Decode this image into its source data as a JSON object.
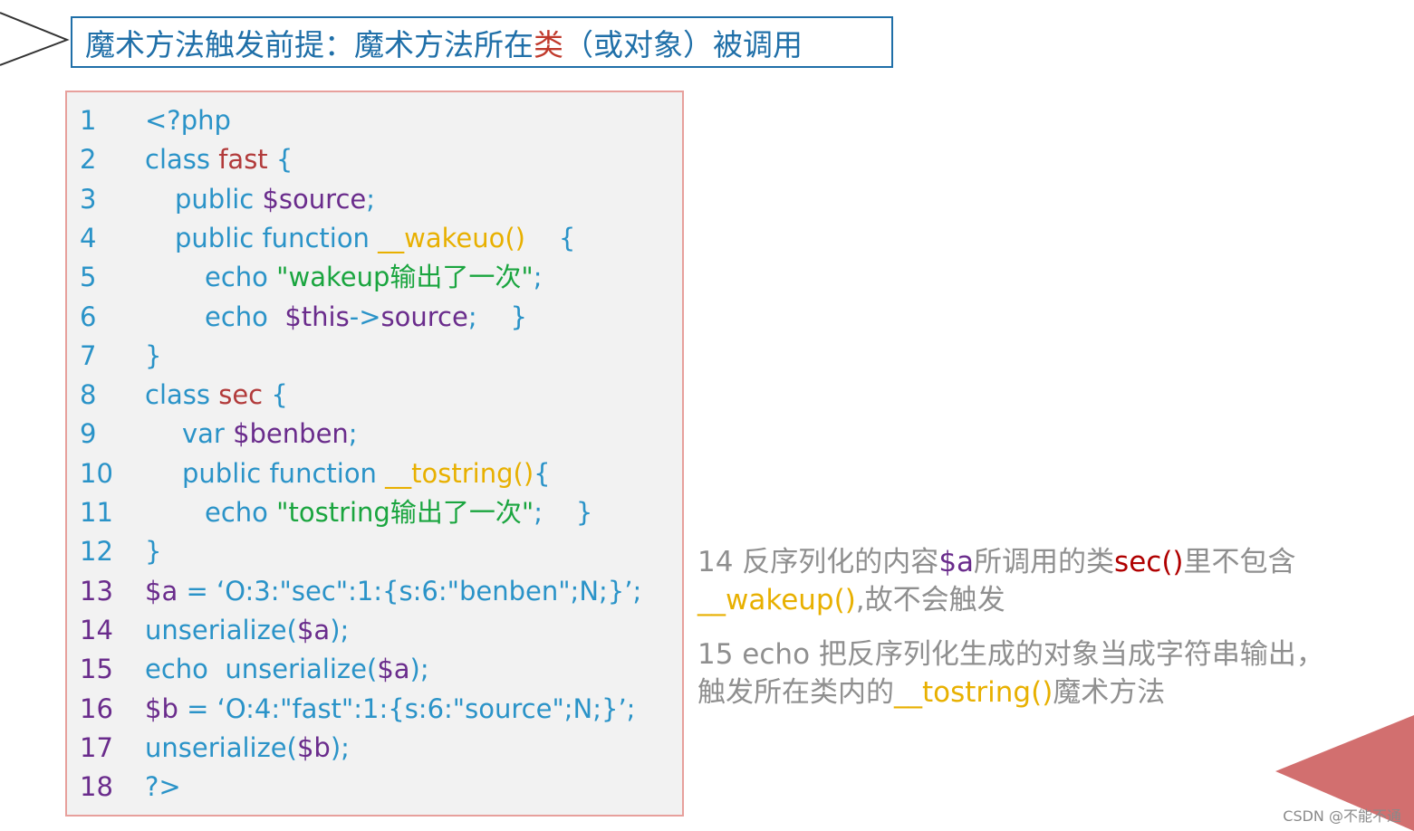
{
  "title": {
    "part1": "魔术方法触发前提：魔术方法所在",
    "part_highlight": "类",
    "part2": "（或对象）被调用"
  },
  "code_lines": [
    {
      "no": "1",
      "segments": [
        {
          "t": "<?php",
          "c": "kw"
        }
      ]
    },
    {
      "no": "2",
      "segments": [
        {
          "t": "class ",
          "c": "kw"
        },
        {
          "t": "fast",
          "c": "cn"
        },
        {
          "t": " {",
          "c": "kw"
        }
      ]
    },
    {
      "no": "3",
      "segments": [
        {
          "t": "public ",
          "c": "kw"
        },
        {
          "t": "$source",
          "c": "vr"
        },
        {
          "t": ";",
          "c": "kw"
        }
      ]
    },
    {
      "no": "4",
      "segments": [
        {
          "t": "public function ",
          "c": "kw"
        },
        {
          "t": "__wakeuo()",
          "c": "fn"
        },
        {
          "t": "    {",
          "c": "kw"
        }
      ]
    },
    {
      "no": "5",
      "segments": [
        {
          "t": "echo ",
          "c": "kw"
        },
        {
          "t": "\"wakeup输出了一次\"",
          "c": "st"
        },
        {
          "t": ";",
          "c": "kw"
        }
      ]
    },
    {
      "no": "6",
      "segments": [
        {
          "t": "echo  ",
          "c": "kw"
        },
        {
          "t": "$this",
          "c": "vr"
        },
        {
          "t": "->",
          "c": "kw"
        },
        {
          "t": "source",
          "c": "vr"
        },
        {
          "t": ";    }",
          "c": "kw"
        }
      ]
    },
    {
      "no": "7",
      "segments": [
        {
          "t": "}",
          "c": "kw"
        }
      ]
    },
    {
      "no": "8",
      "segments": [
        {
          "t": "class ",
          "c": "kw"
        },
        {
          "t": "sec",
          "c": "cn"
        },
        {
          "t": " {",
          "c": "kw"
        }
      ]
    },
    {
      "no": "9",
      "segments": [
        {
          "t": "var ",
          "c": "kw"
        },
        {
          "t": "$benben",
          "c": "vr"
        },
        {
          "t": ";",
          "c": "kw"
        }
      ]
    },
    {
      "no": "10",
      "segments": [
        {
          "t": "public function ",
          "c": "kw"
        },
        {
          "t": "__tostring()",
          "c": "fn"
        },
        {
          "t": "{",
          "c": "kw"
        }
      ]
    },
    {
      "no": "11",
      "segments": [
        {
          "t": "echo ",
          "c": "kw"
        },
        {
          "t": "\"tostring输出了一次\"",
          "c": "st"
        },
        {
          "t": ";    }",
          "c": "kw"
        }
      ]
    },
    {
      "no": "12",
      "segments": [
        {
          "t": "}",
          "c": "kw"
        }
      ]
    },
    {
      "no": "13",
      "segments": [
        {
          "t": "$a",
          "c": "vr"
        },
        {
          "t": " = ‘O:3:\"sec\":1:{s:6:\"benben\";N;}’;",
          "c": "kw"
        }
      ]
    },
    {
      "no": "14",
      "segments": [
        {
          "t": "unserialize(",
          "c": "kw"
        },
        {
          "t": "$a",
          "c": "vr"
        },
        {
          "t": ");",
          "c": "kw"
        }
      ]
    },
    {
      "no": "15",
      "segments": [
        {
          "t": "echo  unserialize(",
          "c": "kw"
        },
        {
          "t": "$a",
          "c": "vr"
        },
        {
          "t": ");",
          "c": "kw"
        }
      ]
    },
    {
      "no": "16",
      "segments": [
        {
          "t": "$b",
          "c": "vr"
        },
        {
          "t": " = ‘O:4:\"fast\":1:{s:6:\"source\";N;}’;",
          "c": "kw"
        }
      ]
    },
    {
      "no": "17",
      "segments": [
        {
          "t": "unserialize(",
          "c": "kw"
        },
        {
          "t": "$b",
          "c": "vr"
        },
        {
          "t": ");",
          "c": "kw"
        }
      ]
    },
    {
      "no": "18",
      "segments": [
        {
          "t": "?>",
          "c": "kw"
        }
      ]
    }
  ],
  "notes": [
    {
      "segments": [
        {
          "t": "14 反序列化的内容",
          "c": ""
        },
        {
          "t": "$a",
          "c": "pu"
        },
        {
          "t": "所调用的类",
          "c": ""
        },
        {
          "t": "sec()",
          "c": "rd"
        },
        {
          "t": "里不包含",
          "c": ""
        }
      ]
    },
    {
      "segments": [
        {
          "t": "__wakeup()",
          "c": "yl"
        },
        {
          "t": ",故不会触发",
          "c": ""
        }
      ]
    },
    {
      "segments": [
        {
          "t": "15 echo 把反序列化生成的对象当成字符串输出，",
          "c": ""
        }
      ]
    },
    {
      "segments": [
        {
          "t": "触发所在类内的",
          "c": ""
        },
        {
          "t": "__tostring()",
          "c": "yl"
        },
        {
          "t": "魔术方法",
          "c": ""
        }
      ]
    }
  ],
  "watermark": "CSDN @不能不通",
  "colors": {
    "keyword": "#2a93c8",
    "class_name": "#b23b3b",
    "variable": "#6a2c8c",
    "function": "#e8b000",
    "string": "#1aa53f",
    "note_text": "#8f8f8f",
    "title": "#1f6fa8",
    "title_highlight": "#c0392b",
    "code_border": "#e7a09c",
    "code_bg": "#f2f2f2",
    "corner_triangle": "#d26f6f"
  }
}
